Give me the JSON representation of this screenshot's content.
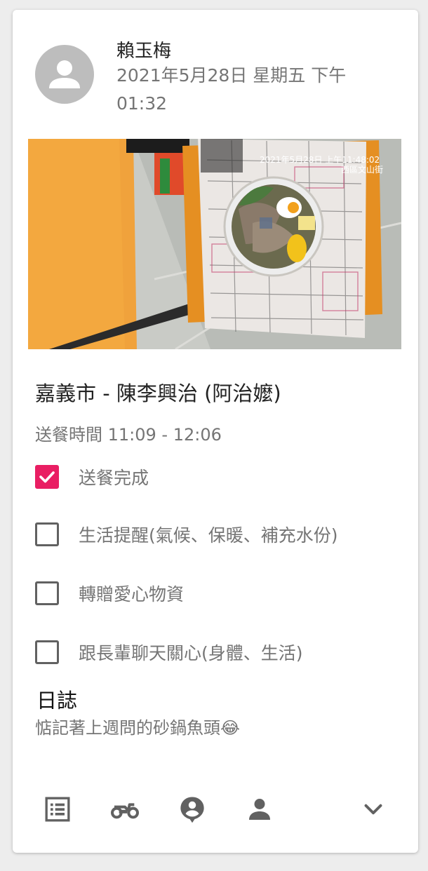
{
  "header": {
    "user_name": "賴玉梅",
    "datetime": "2021年5月28日 星期五 下午 01:32",
    "avatar_icon": "person-icon"
  },
  "photo": {
    "timestamp_overlay": "2021年5月28日 上午11:48:02",
    "location_overlay": "西區文山街"
  },
  "record": {
    "title": "嘉義市 - 陳李興治 (阿治嬤)",
    "delivery_time": "送餐時間 11:09 - 12:06"
  },
  "checklist": [
    {
      "label": "送餐完成",
      "checked": true
    },
    {
      "label": "生活提醒(氣候、保暖、補充水份)",
      "checked": false
    },
    {
      "label": "轉贈愛心物資",
      "checked": false
    },
    {
      "label": "跟長輩聊天關心(身體、生活)",
      "checked": false
    }
  ],
  "log": {
    "heading": "日誌",
    "text": "惦記著上週問的砂鍋魚頭😂"
  },
  "actions": [
    {
      "icon": "list-icon"
    },
    {
      "icon": "motorcycle-icon"
    },
    {
      "icon": "account-pin-icon"
    },
    {
      "icon": "person-icon"
    },
    {
      "icon": "chevron-down-icon"
    }
  ],
  "colors": {
    "accent": "#e91e63",
    "icon": "#616161",
    "secondary_text": "#757575"
  }
}
